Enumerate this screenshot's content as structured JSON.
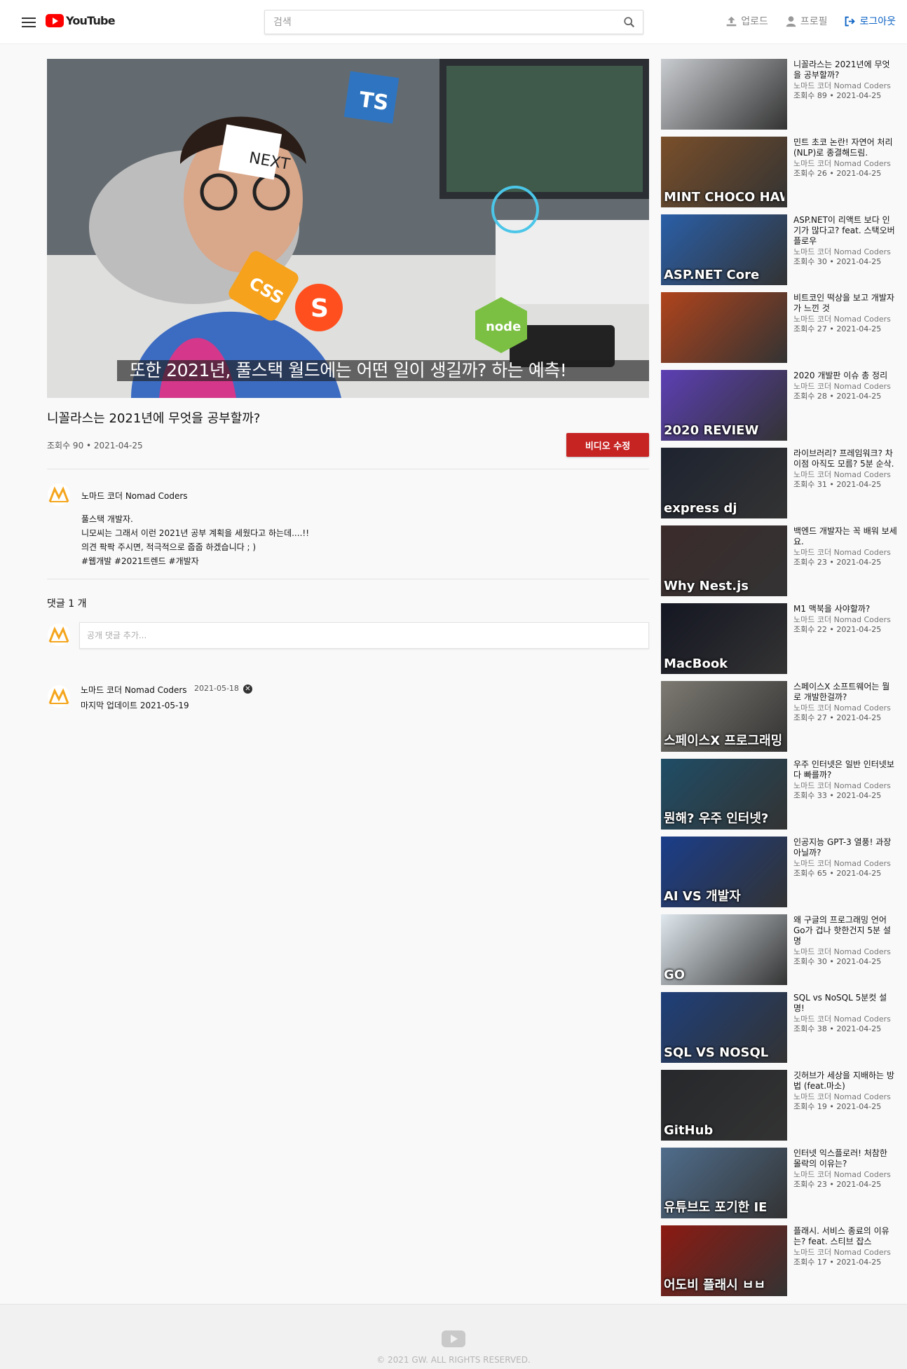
{
  "header": {
    "logo_text": "YouTube",
    "search_placeholder": "검색",
    "upload_label": "업로드",
    "profile_label": "프로필",
    "logout_label": "로그아웃"
  },
  "video": {
    "subtitle": "또한 2021년, 풀스택 월드에는 어떤 일이 생길까? 하는 예측!",
    "title": "니꼴라스는 2021년에 무엇을 공부할까?",
    "meta": "조회수 90  •  2021-04-25",
    "edit_button": "비디오 수정",
    "overlay_labels": [
      "NEXT",
      "TS",
      "CSS",
      "node",
      "S"
    ]
  },
  "channel": {
    "name": "노마드 코더 Nomad Coders"
  },
  "description": [
    "풀스택 개발자.",
    "니모씨는 그래서 이런 2021년 공부 계획을 세웠다고 하는데....!!",
    "의견 팍팍 주시면, 적극적으로 줍줍 하겠습니다 ; )",
    "#웹개발 #2021트렌드 #개발자"
  ],
  "comments": {
    "count_label": "댓글 1 개",
    "input_placeholder": "공개 댓글 추가...",
    "items": [
      {
        "author": "노마드 코더 Nomad Coders",
        "date": "2021-05-18",
        "text": "마지막 업데이트 2021-05-19"
      }
    ]
  },
  "recommended": [
    {
      "title": "니꼴라스는 2021년에 무엇을 공부할까?",
      "channel": "노마드 코더 Nomad Coders",
      "meta": "조회수 89 • 2021-04-25",
      "thumb_text": "",
      "bg": "#c9ccd0"
    },
    {
      "title": "민트 초코 논란! 자연어 처리(NLP)로 종결해드림.",
      "channel": "노마드 코더 Nomad Coders",
      "meta": "조회수 26 • 2021-04-25",
      "thumb_text": "MINT CHOCO  HAWAIIAN PIZZA",
      "bg": "#7a4f2a"
    },
    {
      "title": "ASP.NET이 리액트 보다 인기가 많다고? feat. 스택오버플로우",
      "channel": "노마드 코더 Nomad Coders",
      "meta": "조회수 30 • 2021-04-25",
      "thumb_text": "ASP.NET Core",
      "bg": "#2a5fa8"
    },
    {
      "title": "비트코인 떡상을 보고 개발자가 느낀 것",
      "channel": "노마드 코더 Nomad Coders",
      "meta": "조회수 27 • 2021-04-25",
      "thumb_text": "",
      "bg": "#b0441c"
    },
    {
      "title": "2020 개발판 이슈 총 정리",
      "channel": "노마드 코더 Nomad Coders",
      "meta": "조회수 28 • 2021-04-25",
      "thumb_text": "2020 REVIEW",
      "bg": "#5c3fb4"
    },
    {
      "title": "라이브러리? 프레임워크? 차이점 아직도 모름? 5분 순삭.",
      "channel": "노마드 코더 Nomad Coders",
      "meta": "조회수 31 • 2021-04-25",
      "thumb_text": "express  dj",
      "bg": "#1d2330"
    },
    {
      "title": "백엔드 개발자는 꼭 배워 보세요.",
      "channel": "노마드 코더 Nomad Coders",
      "meta": "조회수 23 • 2021-04-25",
      "thumb_text": "Why Nest.js",
      "bg": "#3b2b2b"
    },
    {
      "title": "M1 맥북을 사야할까?",
      "channel": "노마드 코더 Nomad Coders",
      "meta": "조회수 22 • 2021-04-25",
      "thumb_text": "MacBook",
      "bg": "#141622"
    },
    {
      "title": "스페이스X 소프트웨어는 뭘로 개발한걸까?",
      "channel": "노마드 코더 Nomad Coders",
      "meta": "조회수 27 • 2021-04-25",
      "thumb_text": "스페이스X 프로그래밍 언어",
      "bg": "#7d7a72"
    },
    {
      "title": "우주 인터넷은 일반 인터넷보다 빠를까?",
      "channel": "노마드 코더 Nomad Coders",
      "meta": "조회수 33 • 2021-04-25",
      "thumb_text": "뭔해? 우주 인터넷?",
      "bg": "#1f4d66"
    },
    {
      "title": "인공지능 GPT-3 열풍! 과장 아닐까?",
      "channel": "노마드 코더 Nomad Coders",
      "meta": "조회수 65 • 2021-04-25",
      "thumb_text": "AI VS 개발자",
      "bg": "#1a3d8a"
    },
    {
      "title": "왜 구글의 프로그래밍 언어 Go가 겁나 핫한건지 5분 설명",
      "channel": "노마드 코더 Nomad Coders",
      "meta": "조회수 30 • 2021-04-25",
      "thumb_text": "GO",
      "bg": "#dfe8ee"
    },
    {
      "title": "SQL vs NoSQL 5분컷 설명!",
      "channel": "노마드 코더 Nomad Coders",
      "meta": "조회수 38 • 2021-04-25",
      "thumb_text": "SQL VS NOSQL",
      "bg": "#1e3f7a"
    },
    {
      "title": "깃허브가 세상을 지배하는 방법 (feat.마소)",
      "channel": "노마드 코더 Nomad Coders",
      "meta": "조회수 19 • 2021-04-25",
      "thumb_text": "GitHub",
      "bg": "#26282b"
    },
    {
      "title": "인터넷 익스플로러! 처참한 몰락의 이유는?",
      "channel": "노마드 코더 Nomad Coders",
      "meta": "조회수 23 • 2021-04-25",
      "thumb_text": "유튜브도 포기한 IE",
      "bg": "#4f6d8c"
    },
    {
      "title": "플래시. 서비스 종료의 이유는? feat. 스티브 잡스",
      "channel": "노마드 코더 Nomad Coders",
      "meta": "조회수 17 • 2021-04-25",
      "thumb_text": "어도비 플래시 ㅂㅂ",
      "bg": "#8c1a12"
    }
  ],
  "footer": {
    "copyright": "© 2021 GW. ALL RIGHTS RESERVED."
  },
  "colors": {
    "brand_red": "#ff0000",
    "edit_button": "#c62323",
    "link_blue": "#0b62c4",
    "avatar_orange": "#f4a51c"
  }
}
